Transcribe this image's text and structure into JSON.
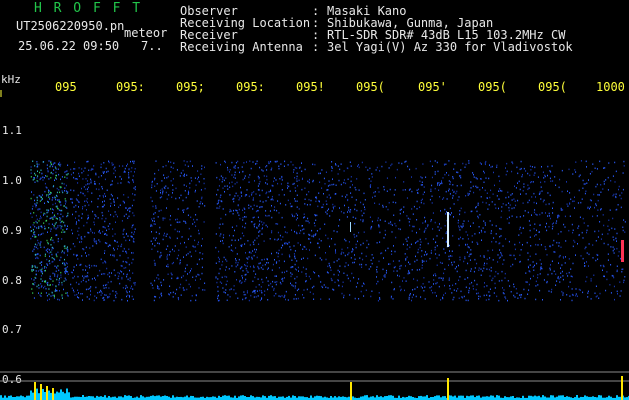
{
  "header": {
    "brand": "H R O F F T",
    "file_name": "UT2506220950.pn",
    "file_tag": "meteor",
    "date_time": "25.06.22 09:50",
    "count": "7..",
    "fields": [
      {
        "label": "Observer",
        "value": "Masaki Kano"
      },
      {
        "label": "Receiving Location",
        "value": "Shibukawa, Gunma, Japan"
      },
      {
        "label": "Receiver",
        "value": "RTL-SDR SDR# 43dB L15 103.2MHz CW"
      },
      {
        "label": "Receiving Antenna",
        "value": "3el Yagi(V) Az 330 for Vladivostok"
      }
    ]
  },
  "axis": {
    "unit": "kHz",
    "x_ticks": [
      "095",
      "095:",
      "095;",
      "095:",
      "095!",
      "095(",
      "095'",
      "095(",
      "095(",
      "1000"
    ],
    "y_ticks": [
      "1.1",
      "1.0",
      "0.9",
      "0.8",
      "0.7",
      "0.6"
    ]
  },
  "colors": {
    "background": "#000000",
    "text": "#e8e8e8",
    "brand": "#22c64a",
    "ticks": "#ffff3a",
    "signal": "#2a5cff",
    "power": "#00c8ff",
    "spike": "#ffe600"
  }
}
